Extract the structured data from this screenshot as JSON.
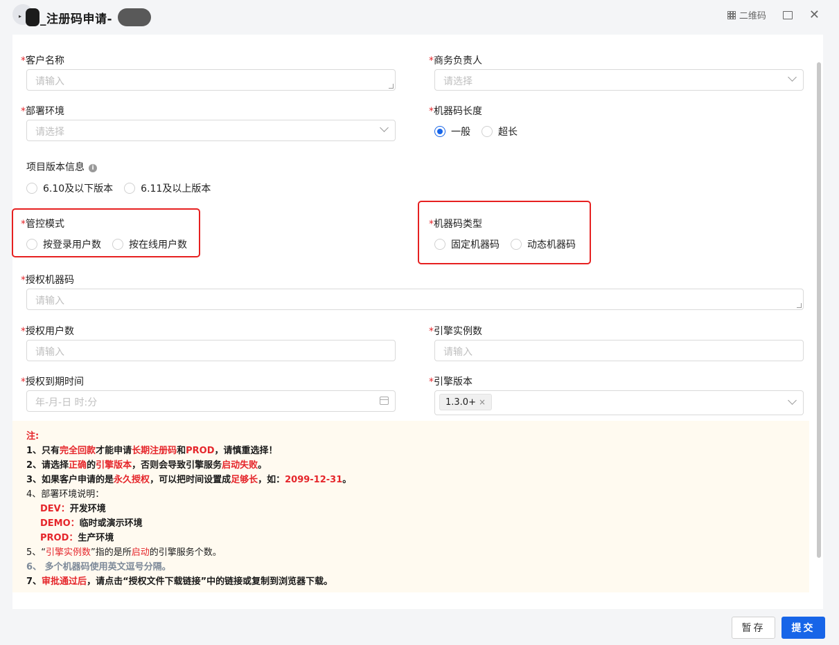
{
  "window": {
    "title": "_注册码申请-",
    "qr_label": "二维码"
  },
  "form": {
    "customer_name": {
      "label": "客户名称",
      "placeholder": "请输入"
    },
    "biz_owner": {
      "label": "商务负责人",
      "placeholder": "请选择"
    },
    "deploy_env": {
      "label": "部署环境",
      "placeholder": "请选择"
    },
    "machine_code_length": {
      "label": "机器码长度",
      "options": [
        "一般",
        "超长"
      ],
      "selected": "一般"
    },
    "project_version": {
      "label": "项目版本信息",
      "info_icon": "i",
      "options": [
        "6.10及以下版本",
        "6.11及以上版本"
      ]
    },
    "control_mode": {
      "label": "管控模式",
      "options": [
        "按登录用户数",
        "按在线用户数"
      ]
    },
    "machine_code_type": {
      "label": "机器码类型",
      "options": [
        "固定机器码",
        "动态机器码"
      ]
    },
    "auth_machine_code": {
      "label": "授权机器码",
      "placeholder": "请输入"
    },
    "auth_users": {
      "label": "授权用户数",
      "placeholder": "请输入"
    },
    "engine_instances": {
      "label": "引擎实例数",
      "placeholder": "请输入"
    },
    "expire_time": {
      "label": "授权到期时间",
      "placeholder": "年-月-日 时:分"
    },
    "engine_version": {
      "label": "引擎版本",
      "tag": "1.3.0+",
      "tag_close": "×"
    },
    "required_mark": "*"
  },
  "note": {
    "title": "注:",
    "l1": {
      "a": "1、只有",
      "b": "完全回款",
      "c": "才能申请",
      "d": "长期注册码",
      "e": "和",
      "f": "PROD",
      "g": "，请慎重选择！"
    },
    "l2": {
      "a": "2、请选择",
      "b": "正确",
      "c": "的",
      "d": "引擎版本",
      "e": "，否则会导致引擎服务",
      "f": "启动失败",
      "g": "。"
    },
    "l3": {
      "a": "3、如果客户申请的是",
      "b": "永久授权",
      "c": "，可以把时间设置成",
      "d": "足够长",
      "e": "，如：",
      "f": "2099-12-31",
      "g": "。"
    },
    "l4": "4、部署环境说明：",
    "l4a": {
      "k": "DEV：",
      "v": "开发环境"
    },
    "l4b": {
      "k": "DEMO：",
      "v": "临时或演示环境"
    },
    "l4c": {
      "k": "PROD：",
      "v": "生产环境"
    },
    "l5": {
      "a": "5、“",
      "b": "引擎实例数",
      "c": "”指的是所",
      "d": "启动",
      "e": "的引擎服务个数。"
    },
    "l6": "6、   多个机器码使用英文逗号分隔。",
    "l7": {
      "a": "7、",
      "b": "审批通过后",
      "c": "，请点击“授权文件下载链接”中的链接或复制到浏览器下载。"
    }
  },
  "footer": {
    "save_label": "暂存",
    "submit_label": "提交"
  },
  "colors": {
    "accent": "#1765e8",
    "required": "#e5262b",
    "highlight_box": "#e62020",
    "note_bg": "#fffaf0"
  }
}
